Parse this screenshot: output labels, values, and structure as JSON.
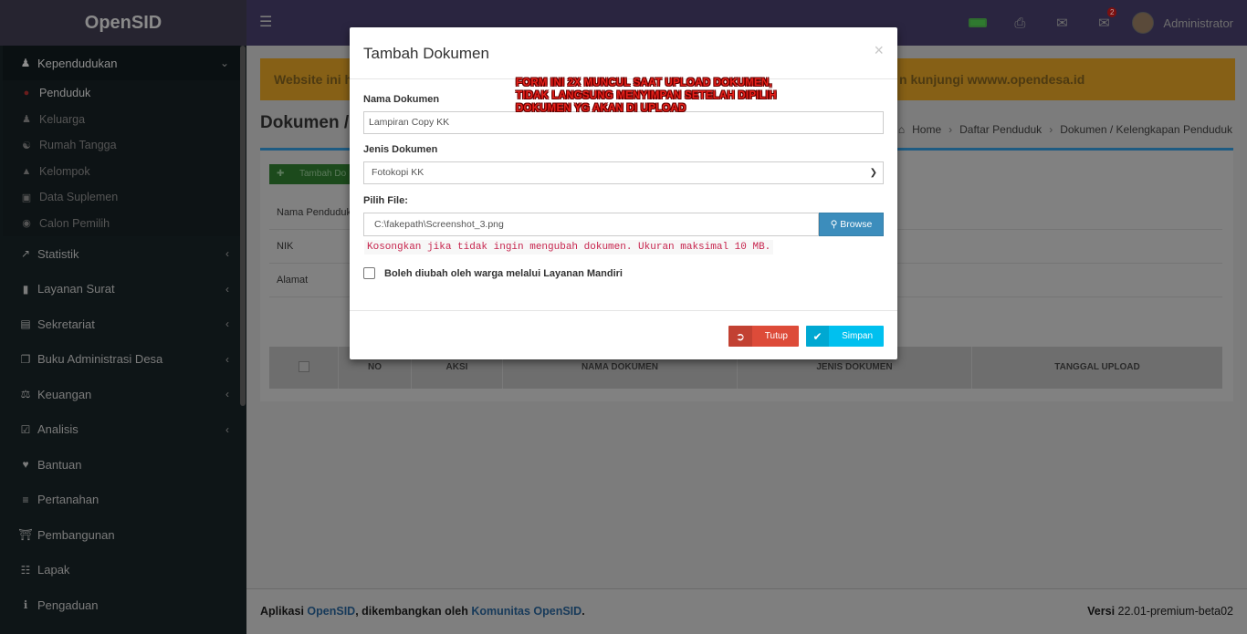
{
  "app": {
    "brand": "OpenSID"
  },
  "topbar": {
    "notif_count": "2",
    "user_name": "Administrator"
  },
  "sidebar": {
    "items": [
      {
        "label": "Kependudukan",
        "icon": "users-icon",
        "expanded": true
      },
      {
        "label": "Statistik",
        "icon": "line-chart-icon"
      },
      {
        "label": "Layanan Surat",
        "icon": "book-icon"
      },
      {
        "label": "Sekretariat",
        "icon": "archive-icon"
      },
      {
        "label": "Buku Administrasi Desa",
        "icon": "copy-icon"
      },
      {
        "label": "Keuangan",
        "icon": "balance-scale-icon"
      },
      {
        "label": "Analisis",
        "icon": "check-square-icon"
      },
      {
        "label": "Bantuan",
        "icon": "heart-icon"
      },
      {
        "label": "Pertanahan",
        "icon": "road-icon"
      },
      {
        "label": "Pembangunan",
        "icon": "bank-icon"
      },
      {
        "label": "Lapak",
        "icon": "cart-icon"
      },
      {
        "label": "Pengaduan",
        "icon": "info-icon"
      }
    ],
    "sub_items": [
      {
        "label": "Penduduk",
        "icon": "user-icon"
      },
      {
        "label": "Keluarga",
        "icon": "users-icon"
      },
      {
        "label": "Rumah Tangga",
        "icon": "comments-icon"
      },
      {
        "label": "Kelompok",
        "icon": "sitemap-icon"
      },
      {
        "label": "Data Suplemen",
        "icon": "inbox-icon"
      },
      {
        "label": "Calon Pemilih",
        "icon": "globe-icon"
      }
    ]
  },
  "banner": {
    "left_text": "Website ini h",
    "right_text": "n kunjungi wwww.opendesa.id"
  },
  "page": {
    "title": "Dokumen /",
    "breadcrumb": [
      "Home",
      "Daftar Penduduk",
      "Dokumen / Kelengkapan Penduduk"
    ],
    "add_button": "Tambah Do",
    "info_rows": [
      "Nama Penduduk",
      "NIK",
      "Alamat"
    ],
    "table_headers": [
      "NO",
      "AKSI",
      "NAMA DOKUMEN",
      "JENIS DOKUMEN",
      "TANGGAL UPLOAD"
    ]
  },
  "footer": {
    "prefix": "Aplikasi ",
    "app_link": "OpenSID",
    "middle": ", dikembangkan oleh ",
    "community_link": "Komunitas OpenSID",
    "suffix": ".",
    "version_label": "Versi",
    "version": "22.01-premium-beta02"
  },
  "modal": {
    "title": "Tambah Dokumen",
    "close_glyph": "×",
    "annotation": [
      "FORM INI 2X MUNCUL SAAT UPLOAD DOKUMEN,",
      "TIDAK LANGSUNG MENYIMPAN SETELAH DIPILIH",
      "DOKUMEN YG AKAN DI UPLOAD"
    ],
    "nama_label": "Nama Dokumen",
    "nama_value": "Lampiran Copy KK",
    "jenis_label": "Jenis Dokumen",
    "jenis_value": "Fotokopi KK",
    "file_label": "Pilih File:",
    "file_value": "C:\\fakepath\\Screenshot_3.png",
    "browse_label": "Browse",
    "hint": "Kosongkan jika tidak ingin mengubah dokumen. Ukuran maksimal 10 MB.",
    "checkbox_label": "Boleh diubah oleh warga melalui Layanan Mandiri",
    "btn_close": "Tutup",
    "btn_save": "Simpan"
  },
  "colors": {
    "danger": "#dd4b39",
    "info": "#00c0ef",
    "primary": "#3c8dbc"
  }
}
